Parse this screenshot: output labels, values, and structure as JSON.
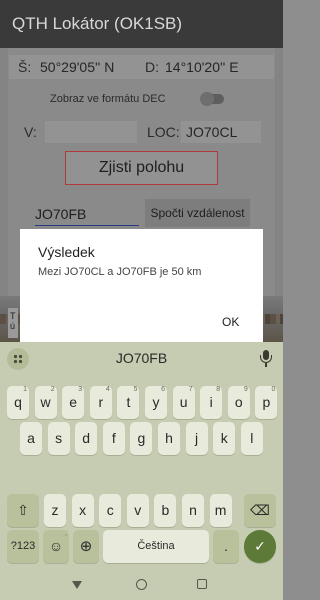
{
  "app": {
    "title": "QTH Lokátor (OK1SB)"
  },
  "form": {
    "lat_label": "Š:",
    "lat_value": "50°29'05'' N",
    "lon_label": "D:",
    "lon_value": "14°10'20'' E",
    "dec_toggle_label": "Zobraz ve formátu DEC",
    "dec_toggle_on": false,
    "v_label": "V:",
    "v_value": "",
    "loc_label": "LOC:",
    "loc_value": "JO70CL",
    "locate_button": "Zjisti polohu",
    "target_locator": "JO70FB",
    "distance_button": "Spočti vzdálenost",
    "partial_card_text": "T ú"
  },
  "dialog": {
    "title": "Výsledek",
    "message": "Mezi JO70CL a JO70FB je 50 km",
    "ok_label": "OK"
  },
  "keyboard": {
    "suggestion": "JO70FB",
    "rows": [
      [
        {
          "k": "q",
          "s": "1"
        },
        {
          "k": "w",
          "s": "2"
        },
        {
          "k": "e",
          "s": "3"
        },
        {
          "k": "r",
          "s": "4"
        },
        {
          "k": "t",
          "s": "5"
        },
        {
          "k": "y",
          "s": "6"
        },
        {
          "k": "u",
          "s": "7"
        },
        {
          "k": "i",
          "s": "8"
        },
        {
          "k": "o",
          "s": "9"
        },
        {
          "k": "p",
          "s": "0"
        }
      ],
      [
        {
          "k": "a",
          "s": ""
        },
        {
          "k": "s",
          "s": ""
        },
        {
          "k": "d",
          "s": ""
        },
        {
          "k": "f",
          "s": ""
        },
        {
          "k": "g",
          "s": ""
        },
        {
          "k": "h",
          "s": ""
        },
        {
          "k": "j",
          "s": ""
        },
        {
          "k": "k",
          "s": ""
        },
        {
          "k": "l",
          "s": ""
        }
      ],
      [
        {
          "k": "z",
          "s": ""
        },
        {
          "k": "x",
          "s": ""
        },
        {
          "k": "c",
          "s": ""
        },
        {
          "k": "v",
          "s": ""
        },
        {
          "k": "b",
          "s": ""
        },
        {
          "k": "n",
          "s": ""
        },
        {
          "k": "m",
          "s": ""
        }
      ]
    ],
    "shift_label": "⇧",
    "backspace_label": "⌫",
    "symbols_label": "?123",
    "emoji_label": "☺",
    "emoji_sup": ",",
    "globe_label": "⊕",
    "space_label": "Čeština",
    "period_label": ".",
    "enter_label": "✓"
  },
  "colors": {
    "accent_red": "#b03a3a",
    "enter_green": "#5d7a38",
    "keyboard_bg": "#c5ccb1"
  }
}
